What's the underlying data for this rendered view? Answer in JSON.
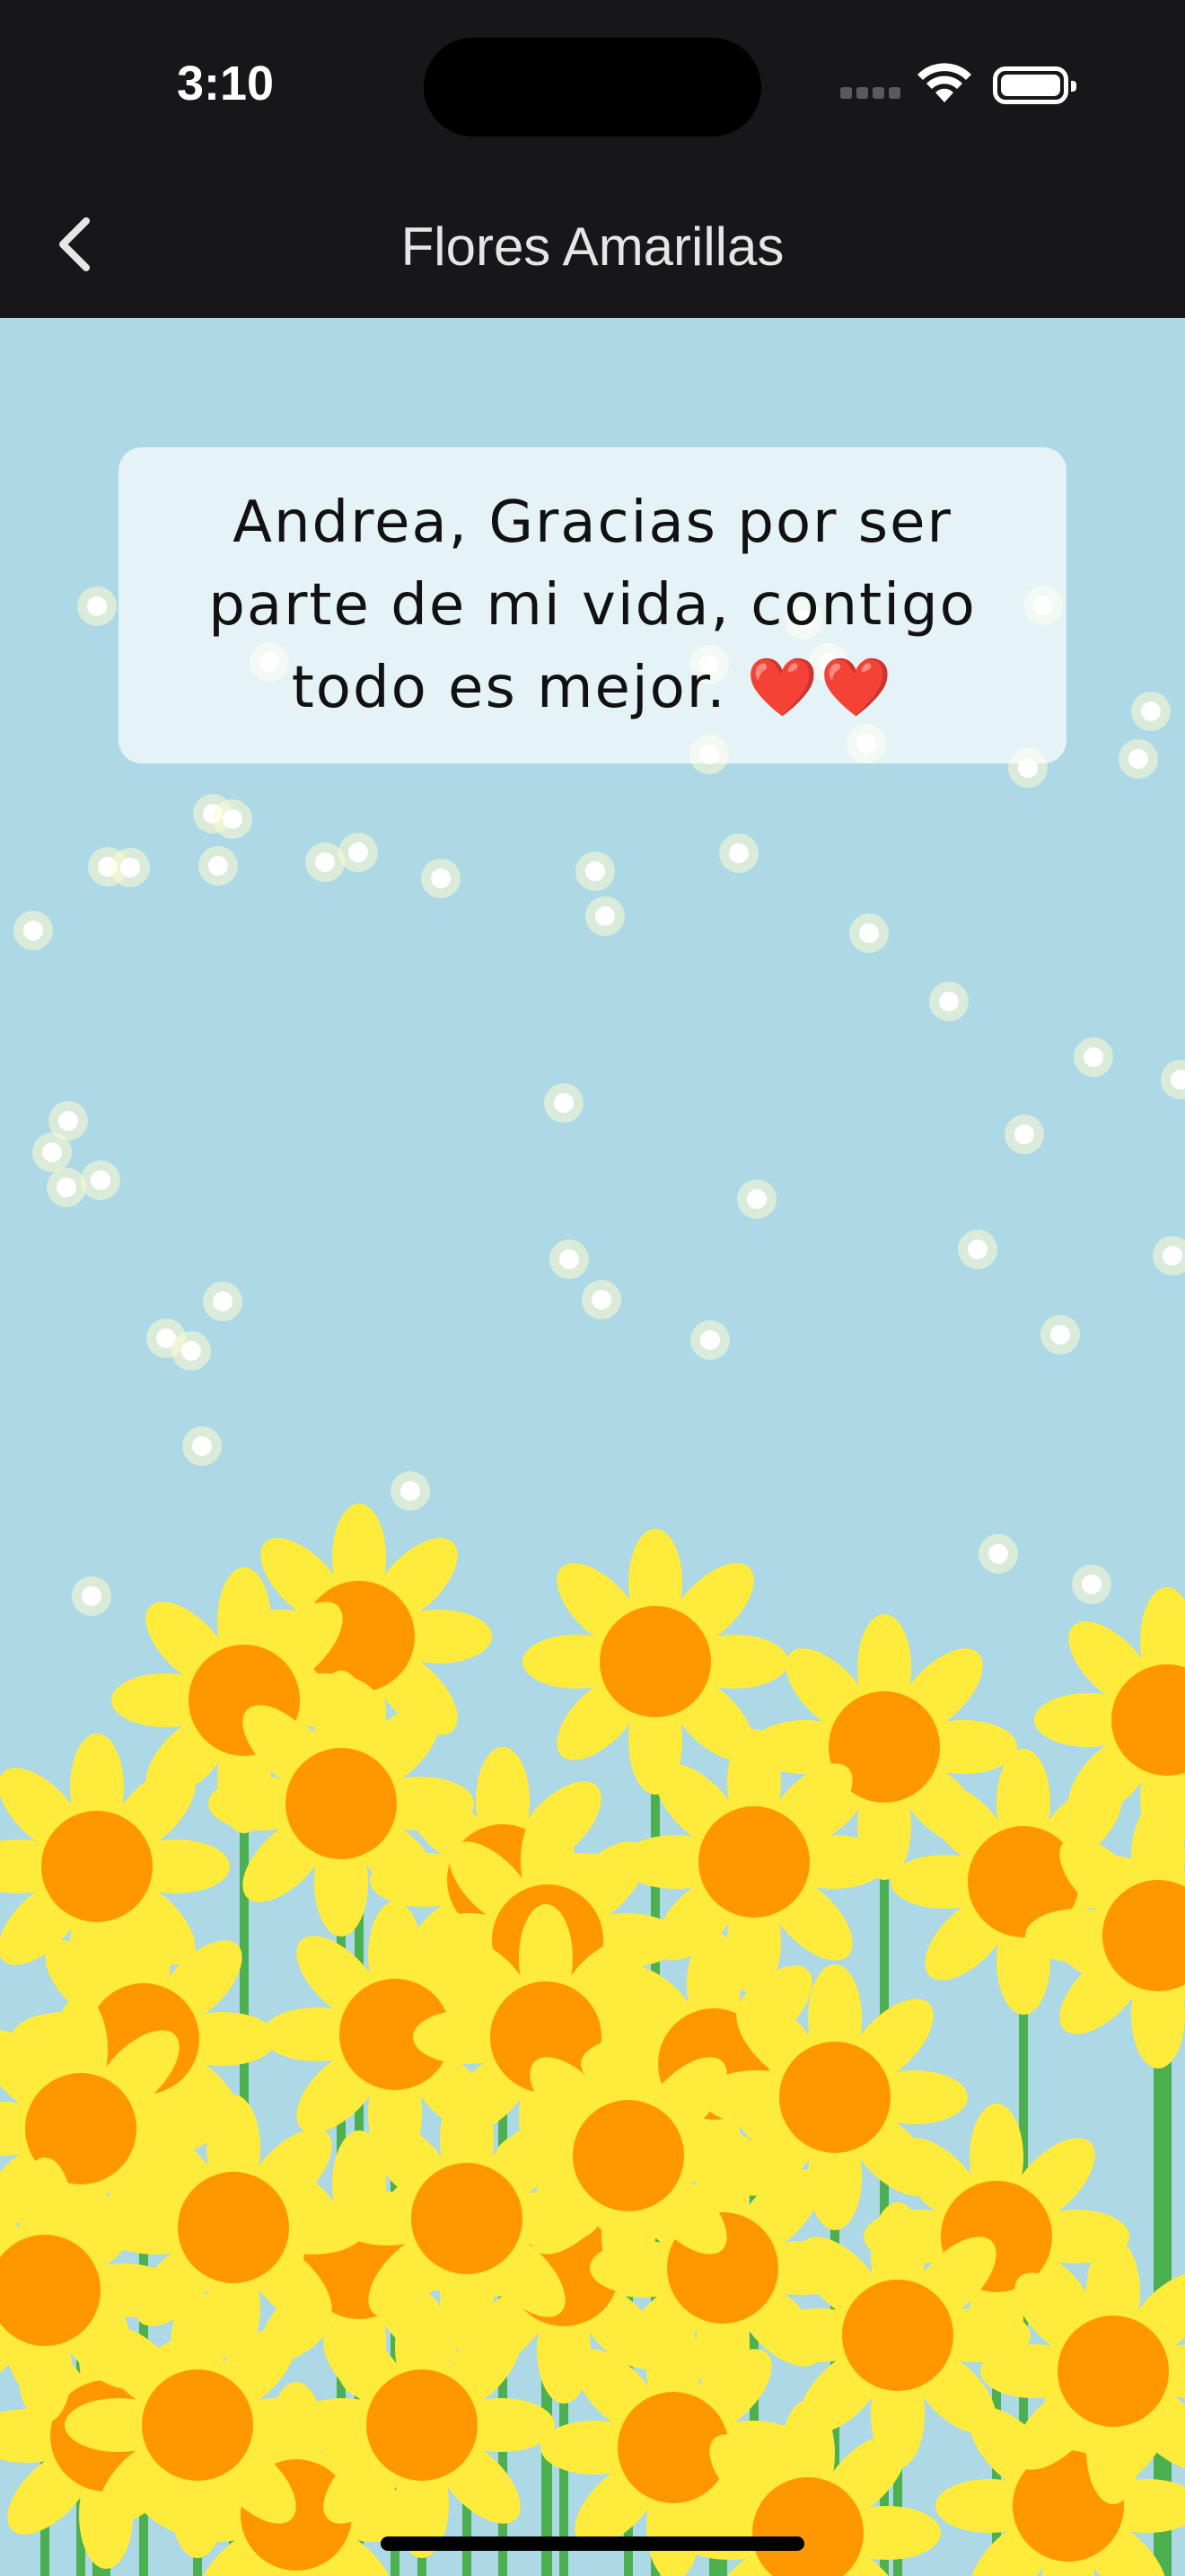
{
  "status": {
    "time": "3:10"
  },
  "header": {
    "title": "Flores Amarillas"
  },
  "message": {
    "text": "Andrea, Gracias por ser parte de mi vida, contigo todo es mejor. ❤️❤️"
  },
  "colors": {
    "sky": "#add8e6",
    "petal": "#ffeb3b",
    "center": "#ff9800",
    "stem": "#4caf50",
    "firefly": "#ffffff",
    "bar": "#17171a"
  },
  "icons": {
    "back": "chevron-left-icon",
    "wifi": "wifi-icon",
    "battery": "battery-icon",
    "signal": "cellular-signal-icon"
  }
}
